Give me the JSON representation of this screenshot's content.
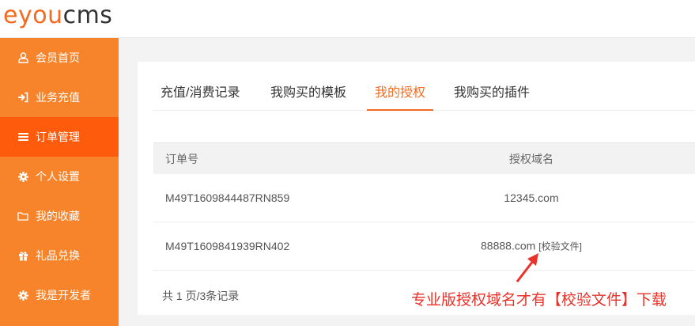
{
  "logo": {
    "part1": "eyou",
    "part2": "cms"
  },
  "sidebar": {
    "items": [
      {
        "label": "会员首页",
        "icon": "user-icon"
      },
      {
        "label": "业务充值",
        "icon": "sign-in-icon"
      },
      {
        "label": "订单管理",
        "icon": "list-icon",
        "active": true
      },
      {
        "label": "个人设置",
        "icon": "gear-icon"
      },
      {
        "label": "我的收藏",
        "icon": "folder-icon"
      },
      {
        "label": "礼品兑换",
        "icon": "gift-icon"
      },
      {
        "label": "我是开发者",
        "icon": "gear-icon"
      }
    ]
  },
  "tabs": [
    {
      "label": "充值/消费记录"
    },
    {
      "label": "我购买的模板"
    },
    {
      "label": "我的授权",
      "active": true
    },
    {
      "label": "我购买的插件"
    }
  ],
  "table": {
    "headers": [
      "订单号",
      "授权域名"
    ],
    "rows": [
      {
        "order": "M49T1609844487RN859",
        "domain": "12345.com",
        "verify": ""
      },
      {
        "order": "M49T1609841939RN402",
        "domain": "88888.com",
        "verify": "[校验文件]"
      }
    ]
  },
  "pager": {
    "text": "共 1 页/3条记录"
  },
  "annotation": {
    "text": "专业版授权域名才有【校验文件】下载"
  },
  "colors": {
    "brand": "#f26b21",
    "sidebar": "#f7842b",
    "sidebar_active": "#ff5b0d",
    "annotation": "#e8322a"
  }
}
